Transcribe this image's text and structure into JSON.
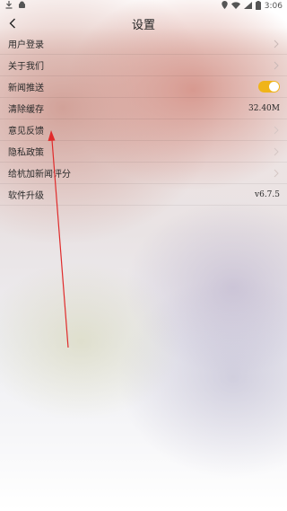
{
  "status_bar": {
    "time": "3:06",
    "icons": [
      "download-icon",
      "android-icon",
      "location-icon",
      "wifi-icon",
      "signal-icon",
      "battery-icon"
    ]
  },
  "navbar": {
    "title": "设置",
    "back_icon": "chevron-left-icon"
  },
  "settings": {
    "items": [
      {
        "label": "用户登录",
        "right": "",
        "type": "link"
      },
      {
        "label": "关于我们",
        "right": "",
        "type": "link"
      },
      {
        "label": "新闻推送",
        "right": "",
        "type": "toggle",
        "toggle_on": true
      },
      {
        "label": "清除缓存",
        "right": "32.40M",
        "type": "value"
      },
      {
        "label": "意见反馈",
        "right": "",
        "type": "link"
      },
      {
        "label": "隐私政策",
        "right": "",
        "type": "link"
      },
      {
        "label": "给杭加新闻评分",
        "right": "",
        "type": "link"
      },
      {
        "label": "软件升级",
        "right": "v6.7.5",
        "type": "value"
      }
    ]
  },
  "colors": {
    "toggle_on": "#f0b419",
    "annotation_arrow": "#e02b2b"
  },
  "annotation": {
    "type": "arrow",
    "points_to": "意见反馈"
  }
}
